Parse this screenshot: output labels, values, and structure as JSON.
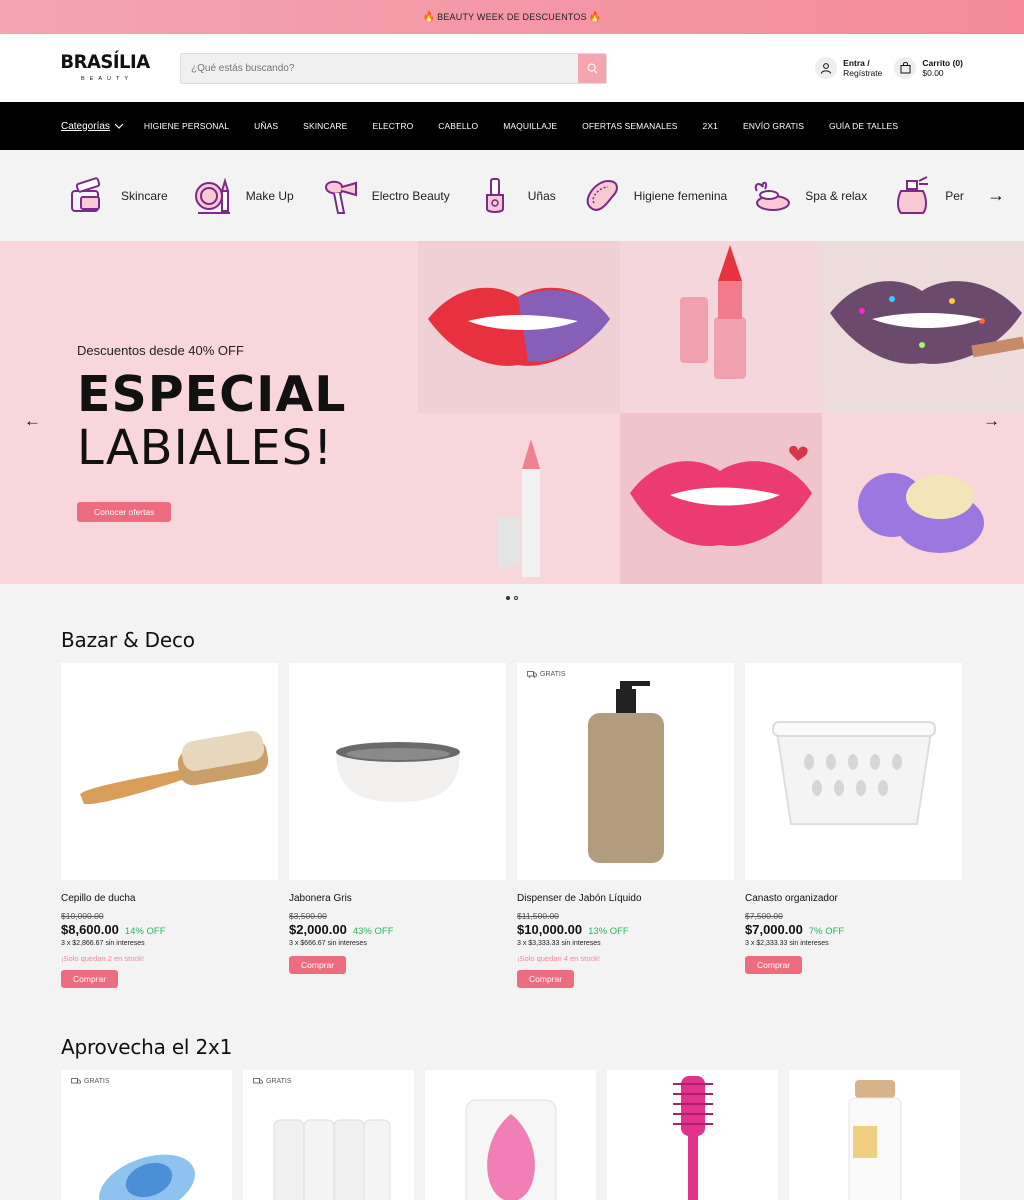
{
  "announcement": {
    "text": "BEAUTY WEEK DE DESCUENTOS"
  },
  "header": {
    "logo_main": "BRASÍLIA",
    "logo_sub": "BEAUTY",
    "search_placeholder": "¿Qué estás buscando?",
    "account_line1": "Entra /",
    "account_line2": "Regístrate",
    "cart_line1": "Carrito (0)",
    "cart_line2": "$0.00"
  },
  "nav": {
    "categories": "Categorías",
    "items": [
      "HIGIENE PERSONAL",
      "UÑAS",
      "SKINCARE",
      "ELECTRO",
      "CABELLO",
      "MAQUILLAJE",
      "OFERTAS SEMANALES",
      "2X1",
      "ENVÍO GRATIS",
      "GUÍA DE TALLES"
    ]
  },
  "categories": [
    {
      "label": "Skincare",
      "icon": "skincare-icon"
    },
    {
      "label": "Make Up",
      "icon": "makeup-icon"
    },
    {
      "label": "Electro Beauty",
      "icon": "hair-dryer-icon"
    },
    {
      "label": "Uñas",
      "icon": "nail-polish-icon"
    },
    {
      "label": "Higiene femenina",
      "icon": "pad-icon"
    },
    {
      "label": "Spa & relax",
      "icon": "spa-icon"
    },
    {
      "label": "Per",
      "icon": "perfume-icon"
    }
  ],
  "hero": {
    "subtitle": "Descuentos desde 40% OFF",
    "title1": "ESPECIAL",
    "title2": "LABIALES!",
    "button": "Conocer ofertas"
  },
  "section1": {
    "title": "Bazar & Deco",
    "products": [
      {
        "name": "Cepillo de ducha",
        "old": "$10,000.00",
        "price": "$8,600.00",
        "off": "14% OFF",
        "installments": "3 x $2,866.67 sin intereses",
        "stock": "¡Solo quedan 2 en stock!",
        "button": "Comprar",
        "badge": ""
      },
      {
        "name": "Jabonera Gris",
        "old": "$3,500.00",
        "price": "$2,000.00",
        "off": "43% OFF",
        "installments": "3 x $666.67 sin intereses",
        "stock": "",
        "button": "Comprar",
        "badge": ""
      },
      {
        "name": "Dispenser de Jabón Líquido",
        "old": "$11,500.00",
        "price": "$10,000.00",
        "off": "13% OFF",
        "installments": "3 x $3,333.33 sin intereses",
        "stock": "¡Solo quedan 4 en stock!",
        "button": "Comprar",
        "badge": "GRATIS"
      },
      {
        "name": "Canasto organizador",
        "old": "$7,500.00",
        "price": "$7,000.00",
        "off": "7% OFF",
        "installments": "3 x $2,333.33 sin intereses",
        "stock": "",
        "button": "Comprar",
        "badge": ""
      }
    ]
  },
  "section2": {
    "title": "Aprovecha el 2x1",
    "badges": [
      "GRATIS",
      "GRATIS",
      "",
      "",
      ""
    ]
  },
  "colors": {
    "accent": "#ee6c80",
    "off_green": "#2db55d",
    "nav_bg": "#000000",
    "hero_bg": "#f7d6dc"
  }
}
